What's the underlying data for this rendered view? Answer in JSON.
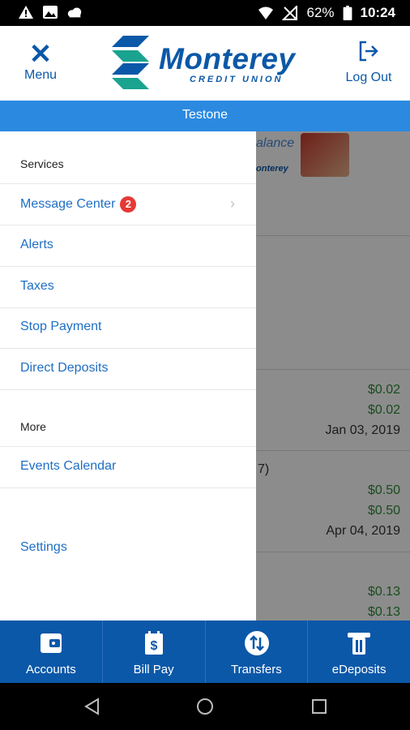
{
  "status_bar": {
    "battery": "62%",
    "time": "10:24"
  },
  "header": {
    "menu_label": "Menu",
    "logout_label": "Log Out",
    "logo_name": "Monterey",
    "logo_sub": "CREDIT UNION"
  },
  "user_bar": {
    "name": "Testone"
  },
  "drawer": {
    "services_heading": "Services",
    "services": [
      {
        "label": "Message Center",
        "badge": "2"
      },
      {
        "label": "Alerts"
      },
      {
        "label": "Taxes"
      },
      {
        "label": "Stop Payment"
      },
      {
        "label": "Direct Deposits"
      }
    ],
    "more_heading": "More",
    "more": [
      {
        "label": "Events Calendar"
      },
      {
        "label": "Settings"
      }
    ]
  },
  "background": {
    "banner_text": "alance",
    "banner_mini": "onterey",
    "rows": [
      {
        "val1": "$0.02",
        "val2": "$0.02",
        "date": "Jan 03, 2019"
      },
      {
        "fragment": "7)",
        "val1": "$0.50",
        "val2": "$0.50",
        "date": "Apr 04, 2019"
      },
      {
        "val1": "$0.13",
        "val2": "$0.13"
      }
    ]
  },
  "tab_bar": {
    "tabs": [
      {
        "label": "Accounts",
        "icon": "wallet-icon"
      },
      {
        "label": "Bill Pay",
        "icon": "bill-icon"
      },
      {
        "label": "Transfers",
        "icon": "transfer-icon"
      },
      {
        "label": "eDeposits",
        "icon": "check-deposit-icon"
      }
    ]
  },
  "colors": {
    "brand_blue": "#0b58a8",
    "user_bar": "#2b8ae0",
    "amount_green": "#2e8b3a",
    "badge_red": "#e53935"
  }
}
